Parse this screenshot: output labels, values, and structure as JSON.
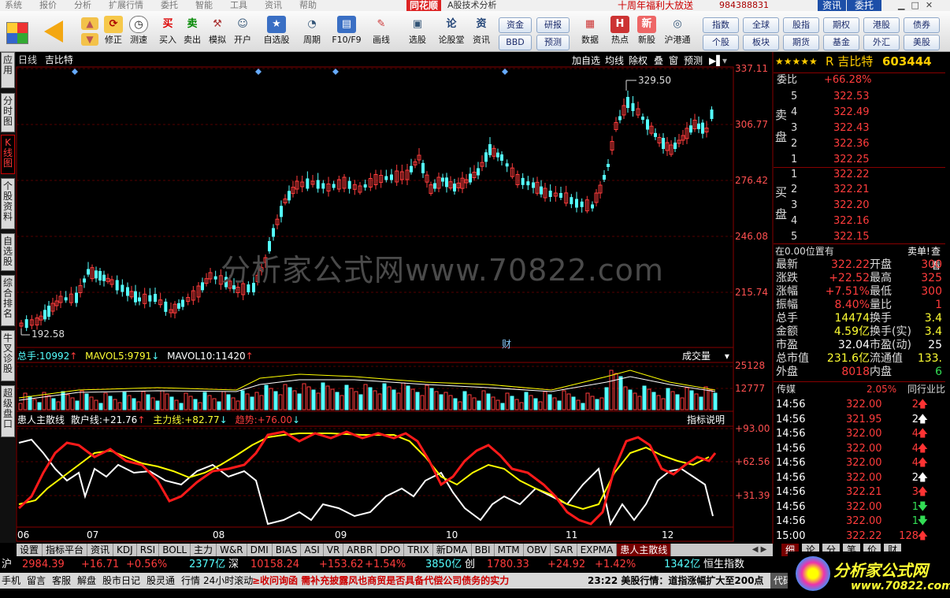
{
  "menu": [
    "系统",
    "报价",
    "分析",
    "扩展行情",
    "委托",
    "智能",
    "工具",
    "资讯",
    "帮助"
  ],
  "app_logo": "同花顺",
  "app_title": "A股技术分析",
  "promo": "十周年福利大放送",
  "account": "984388831",
  "top_tabs": [
    "资讯",
    "委托"
  ],
  "toolbar": [
    "修正",
    "测速",
    "买入",
    "卖出",
    "模拟",
    "开户",
    "自选股",
    "周期",
    "F10/F9",
    "画线",
    "选股",
    "论股堂",
    "资讯",
    "资金",
    "BBD",
    "研报",
    "预测",
    "数据",
    "热点",
    "新股",
    "沪港通"
  ],
  "toolbar_right": [
    "指数",
    "全球",
    "股指",
    "期权",
    "港股",
    "债券",
    "个股",
    "板块",
    "期货",
    "基金",
    "外汇",
    "美股"
  ],
  "toolbar_icons": {
    "buy": "买",
    "sell": "卖",
    "lun": "论",
    "zixun": "资"
  },
  "left_tabs": [
    "应用",
    "分时图",
    "K线图",
    "个股资料",
    "自选股",
    "综合排名",
    "牛叉诊股",
    "超级盘口"
  ],
  "chart": {
    "period": "日线",
    "stock": "吉比特",
    "options": [
      "加自选",
      "均线",
      "除权",
      "叠",
      "窗",
      "预测"
    ],
    "cai": "财",
    "high_label": "329.50",
    "low_label": "192.58",
    "price_ticks": [
      "337.11",
      "306.77",
      "276.42",
      "246.08",
      "215.74"
    ],
    "vol_ticks": [
      "25128",
      "12777"
    ],
    "ind_ticks": [
      "93.00",
      "62.56",
      "31.39"
    ],
    "months": [
      "06",
      "07",
      "08",
      "09",
      "10",
      "11",
      "12"
    ],
    "watermark": "分析家公式网www.70822.com"
  },
  "volume": {
    "label": "总手:",
    "value": "10992",
    "ma5_label": "MAVOL5:",
    "ma5": "9791",
    "ma10_label": "MAVOL10:",
    "ma10": "11420",
    "menu": "成交量"
  },
  "indicator": {
    "name": "患人主散线",
    "retail_label": "散户线:",
    "retail": "+21.76",
    "main_label": "主力线:",
    "main": "+82.77",
    "trend_label": "趋势:",
    "trend": "+76.00",
    "help": "指标说明"
  },
  "quote": {
    "title": "R 吉比特",
    "code": "603444",
    "weibi_label": "委比",
    "weibi": "+66.28%",
    "sell_label": "卖盘",
    "buy_label": "买盘",
    "asks": [
      [
        "5",
        "322.53"
      ],
      [
        "4",
        "322.49"
      ],
      [
        "3",
        "322.43"
      ],
      [
        "2",
        "322.36"
      ],
      [
        "1",
        "322.25"
      ]
    ],
    "bids": [
      [
        "1",
        "322.22"
      ],
      [
        "2",
        "322.21"
      ],
      [
        "3",
        "322.20"
      ],
      [
        "4",
        "322.16"
      ],
      [
        "5",
        "322.15"
      ]
    ],
    "pos_text": "在0.00位置有",
    "pos_btn1": "卖单!",
    "pos_btn2": "查看",
    "stats": [
      [
        "最新",
        "322.22",
        "开盘",
        "300"
      ],
      [
        "涨跌",
        "+22.52",
        "最高",
        "325"
      ],
      [
        "涨幅",
        "+7.51%",
        "最低",
        "300"
      ],
      [
        "振幅",
        "8.40%",
        "量比",
        "1"
      ],
      [
        "总手",
        "14474",
        "换手",
        "3.4"
      ],
      [
        "金额",
        "4.59亿",
        "换手(实)",
        "3.4"
      ],
      [
        "市盈",
        "32.04",
        "市盈(动)",
        "25"
      ],
      [
        "总市值",
        "231.6亿",
        "流通值",
        "133."
      ],
      [
        "外盘",
        "8018",
        "内盘",
        "6"
      ]
    ],
    "sector": "传媒",
    "sector_pct": "2.05%",
    "sector_tab": "同行业比",
    "ticks": [
      [
        "14:56",
        "322.00",
        "2"
      ],
      [
        "14:56",
        "321.95",
        "2"
      ],
      [
        "14:56",
        "322.00",
        "4"
      ],
      [
        "14:56",
        "322.00",
        "4"
      ],
      [
        "14:56",
        "322.00",
        "4"
      ],
      [
        "14:56",
        "322.00",
        "2"
      ],
      [
        "14:56",
        "322.21",
        "3"
      ],
      [
        "14:56",
        "322.00",
        "1"
      ],
      [
        "14:56",
        "322.00",
        "1"
      ],
      [
        "15:00",
        "322.22",
        "128"
      ]
    ],
    "bottom_tabs": [
      "细",
      "论",
      "分",
      "笔",
      "价",
      "财"
    ]
  },
  "bottom_tabs": [
    "设置",
    "指标平台",
    "资讯",
    "KDJ",
    "RSI",
    "BOLL",
    "主力",
    "W&R",
    "DMI",
    "BIAS",
    "ASI",
    "VR",
    "ARBR",
    "DPO",
    "TRIX",
    "新DMA",
    "BBI",
    "MTM",
    "OBV",
    "SAR",
    "EXPMA",
    "患人主散线"
  ],
  "index_bar": [
    [
      "沪",
      "2984.39",
      "+16.71",
      "+0.56%",
      "2377亿"
    ],
    [
      "深",
      "10158.24",
      "+153.62",
      "+1.54%",
      "3850亿"
    ],
    [
      "创",
      "1780.33",
      "+24.92",
      "+1.42%",
      "1342亿"
    ],
    [
      "恒生指数",
      "",
      "",
      "",
      ""
    ]
  ],
  "status": [
    "手机",
    "留言",
    "客服",
    "解盘",
    "股市日记",
    "股灵通",
    "行情",
    "24小时滚动"
  ],
  "news_left": "≥收问询函 需补充披露风也商贸是否具备代偿公司债务的实力",
  "news_right": "23:22 美股行情：道指涨幅扩大至200点",
  "code_btn": "代码",
  "corner_logo": "分析家公式网",
  "corner_url": "www.70822.com",
  "colors": {
    "up": "#ff3c3c",
    "down": "#54ffff",
    "ma_white": "#ffffff",
    "ma_yellow": "#ffff00"
  }
}
